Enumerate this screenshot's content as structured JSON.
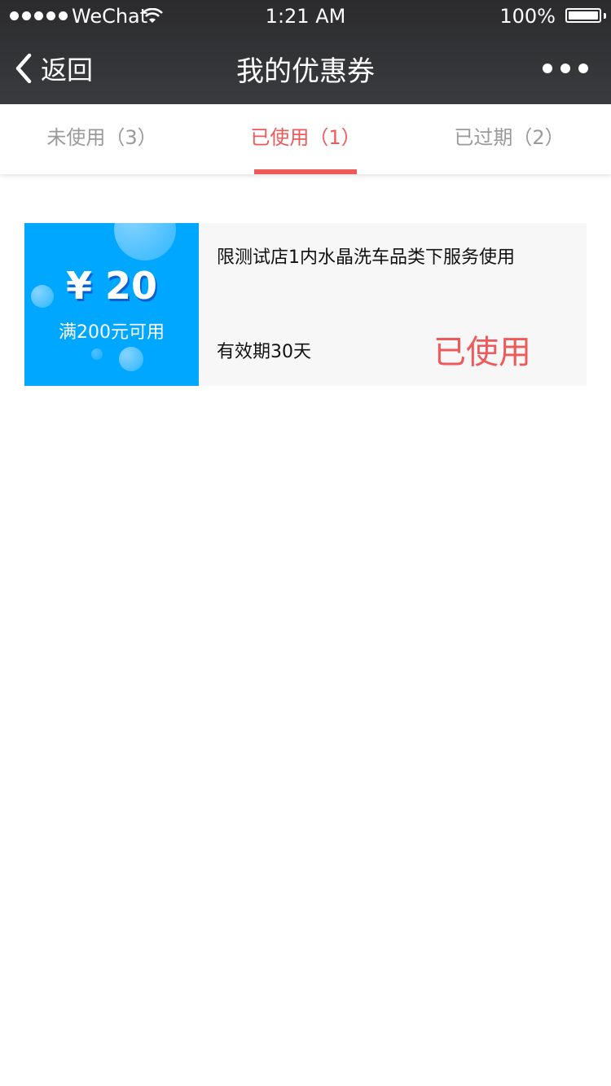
{
  "status_bar": {
    "carrier": "WeChat",
    "time": "1:21 AM",
    "battery": "100%"
  },
  "nav": {
    "back_label": "返回",
    "title": "我的优惠券"
  },
  "tabs": [
    {
      "label": "未使用（3）",
      "active": false
    },
    {
      "label": "已使用（1）",
      "active": true
    },
    {
      "label": "已过期（2）",
      "active": false
    }
  ],
  "coupons": [
    {
      "amount": "¥ 20",
      "condition": "满200元可用",
      "description": "限测试店1内水晶洗车品类下服务使用",
      "validity": "有效期30天",
      "status": "已使用"
    }
  ],
  "colors": {
    "accent": "#ee5a5a",
    "coupon_blue": "#00a7ff",
    "header_bg": "#333437"
  }
}
